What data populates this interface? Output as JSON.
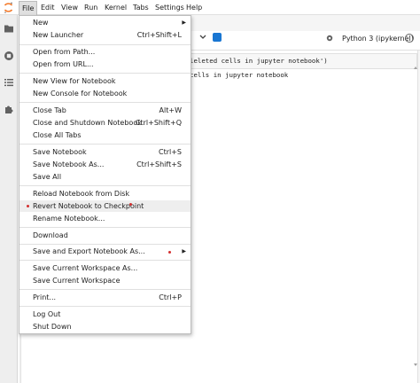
{
  "menubar": {
    "items": [
      "File",
      "Edit",
      "View",
      "Run",
      "Kernel",
      "Tabs",
      "Settings",
      "Help"
    ]
  },
  "sidebar": {
    "icons": [
      "folder-icon",
      "running-icon",
      "commands-icon",
      "extension-icon"
    ]
  },
  "notebook": {
    "kernel_label": "Python 3 (ipykernel)",
    "code_fragment": "leleted cells in jupyter notebook')",
    "output_fragment": "cells in jupyter notebook"
  },
  "file_menu": {
    "new": "New",
    "new_launcher": "New Launcher",
    "new_launcher_shortcut": "Ctrl+Shift+L",
    "open_from_path": "Open from Path...",
    "open_from_url": "Open from URL...",
    "new_view": "New View for Notebook",
    "new_console": "New Console for Notebook",
    "close_tab": "Close Tab",
    "close_tab_shortcut": "Alt+W",
    "close_shutdown": "Close and Shutdown Notebook",
    "close_shutdown_shortcut": "Ctrl+Shift+Q",
    "close_all": "Close All Tabs",
    "save_notebook": "Save Notebook",
    "save_notebook_shortcut": "Ctrl+S",
    "save_as": "Save Notebook As...",
    "save_as_shortcut": "Ctrl+Shift+S",
    "save_all": "Save All",
    "reload": "Reload Notebook from Disk",
    "revert": "Revert Notebook to Checkpoint",
    "rename": "Rename Notebook...",
    "download": "Download",
    "save_export": "Save and Export Notebook As...",
    "save_workspace_as": "Save Current Workspace As...",
    "save_workspace": "Save Current Workspace",
    "print": "Print...",
    "print_shortcut": "Ctrl+P",
    "logout": "Log Out",
    "shutdown": "Shut Down"
  },
  "colors": {
    "accent": "#1976d2",
    "marker_dot": "#d32f2f",
    "hover_bg": "#eeeeee"
  }
}
